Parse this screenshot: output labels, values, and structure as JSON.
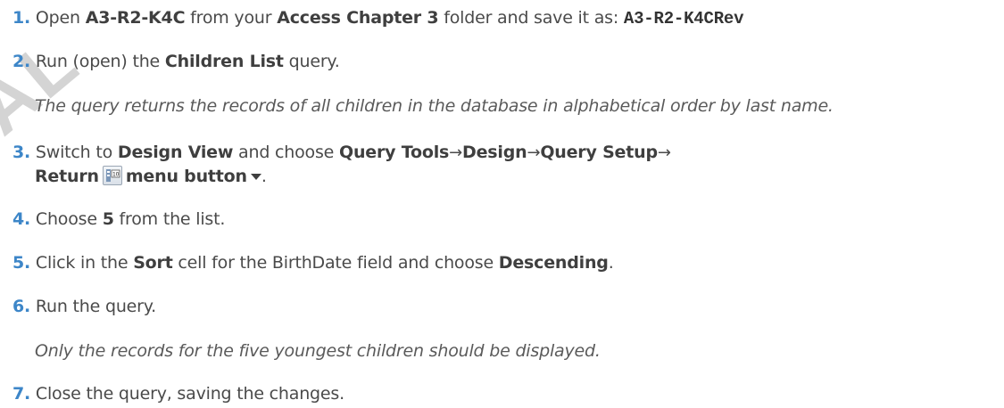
{
  "watermark": "AL",
  "steps": [
    {
      "num": "1.",
      "pre": "Open ",
      "file": "A3-R2-K4C",
      "mid": " from your ",
      "folder": "Access Chapter 3",
      "post": " folder and save it as: ",
      "saveas": "A3-R2-K4CRev"
    },
    {
      "num": "2.",
      "pre": "Run (open) the ",
      "query": "Children List",
      "post": " query.",
      "note": "The query returns the records of all children in the database in alphabetical order by last name."
    },
    {
      "num": "3.",
      "pre": "Switch to ",
      "view": "Design View",
      "mid": " and choose ",
      "path1": "Query Tools",
      "path2": "Design",
      "path3": "Query Setup",
      "arrow": "→",
      "button": "Return",
      "button2": "menu button",
      "post": "."
    },
    {
      "num": "4.",
      "pre": "Choose ",
      "value": "5",
      "post": " from the list."
    },
    {
      "num": "5.",
      "pre": "Click in the ",
      "cell": "Sort",
      "mid": " cell for the BirthDate field and choose ",
      "choice": "Descending",
      "post": "."
    },
    {
      "num": "6.",
      "text": "Run the query.",
      "note": "Only the records for the five youngest children should be displayed."
    },
    {
      "num": "7.",
      "text": "Close the query, saving the changes."
    }
  ]
}
